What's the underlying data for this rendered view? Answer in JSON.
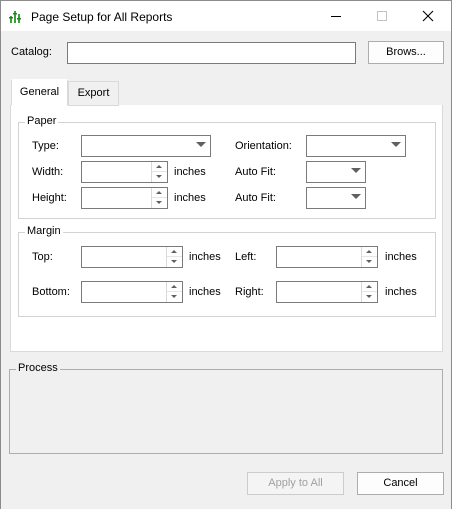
{
  "window": {
    "title": "Page Setup for All Reports",
    "controls": [
      "minimize",
      "maximize",
      "close"
    ]
  },
  "catalog": {
    "label": "Catalog:",
    "value": "",
    "browse_label": "Brows..."
  },
  "tabs": [
    {
      "label": "General",
      "active": true
    },
    {
      "label": "Export",
      "active": false
    }
  ],
  "paper": {
    "title": "Paper",
    "type_label": "Type:",
    "type_value": "",
    "orientation_label": "Orientation:",
    "orientation_value": "",
    "width_label": "Width:",
    "width_value": "",
    "width_unit": "inches",
    "height_label": "Height:",
    "height_value": "",
    "height_unit": "inches",
    "autofit_width_label": "Auto Fit:",
    "autofit_width_value": "",
    "autofit_height_label": "Auto Fit:",
    "autofit_height_value": ""
  },
  "margin": {
    "title": "Margin",
    "top_label": "Top:",
    "top_value": "",
    "top_unit": "inches",
    "left_label": "Left:",
    "left_value": "",
    "left_unit": "inches",
    "bottom_label": "Bottom:",
    "bottom_value": "",
    "bottom_unit": "inches",
    "right_label": "Right:",
    "right_value": "",
    "right_unit": "inches"
  },
  "process": {
    "title": "Process"
  },
  "footer": {
    "apply_label": "Apply to All",
    "apply_enabled": false,
    "cancel_label": "Cancel"
  },
  "colors": {
    "dialog_bg": "#f0f0f0",
    "panel_bg": "#ffffff",
    "border": "#7a7a7a",
    "icon_green": "#3aa13a"
  }
}
